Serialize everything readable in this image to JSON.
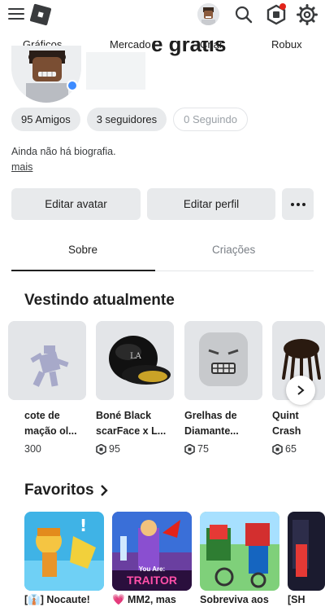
{
  "header": {
    "menu_icon": "hamburger-icon",
    "logo_icon": "roblox-logo-icon",
    "search_icon": "search-icon",
    "robux_icon": "robux-icon",
    "settings_icon": "gear-icon"
  },
  "nav": {
    "items": [
      {
        "label": "Gráficos"
      },
      {
        "label": "Mercado"
      },
      {
        "label": "Criar"
      },
      {
        "label": "Robux"
      }
    ]
  },
  "profile": {
    "name_partial": "e grátis",
    "status_color": "#3d8bff",
    "stats": [
      {
        "label": "95 Amigos"
      },
      {
        "label": "3 seguidores"
      },
      {
        "label": "0 Seguindo"
      }
    ],
    "bio": "Ainda não há biografia.",
    "more_label": "mais",
    "edit_avatar_label": "Editar avatar",
    "edit_profile_label": "Editar perfil",
    "more_options_icon": "more-dots-icon"
  },
  "tabs": {
    "about": "Sobre",
    "creations": "Criações"
  },
  "wearing": {
    "title": "Vestindo atualmente",
    "items": [
      {
        "name_line1": "cote de",
        "name_line2": "mação ol...",
        "price": "300"
      },
      {
        "name_line1": "Boné Black",
        "name_line2": "scarFace x L...",
        "price": "95"
      },
      {
        "name_line1": "Grelhas de",
        "name_line2": "Diamante...",
        "price": "75"
      },
      {
        "name_line1": "Quint",
        "name_line2": "Crash",
        "price": "65"
      }
    ]
  },
  "favorites": {
    "title": "Favoritos",
    "items": [
      {
        "name": "[👔] Nocaute!"
      },
      {
        "name": "💗 MM2, mas"
      },
      {
        "name": "Sobreviva aos"
      },
      {
        "name": "[SH"
      }
    ],
    "traitor_you_are": "You Are:",
    "traitor_label": "TRAITOR"
  },
  "colors": {
    "chip_bg": "#e8eaec",
    "text": "#1f1f1f",
    "notification": "#e2231a"
  }
}
